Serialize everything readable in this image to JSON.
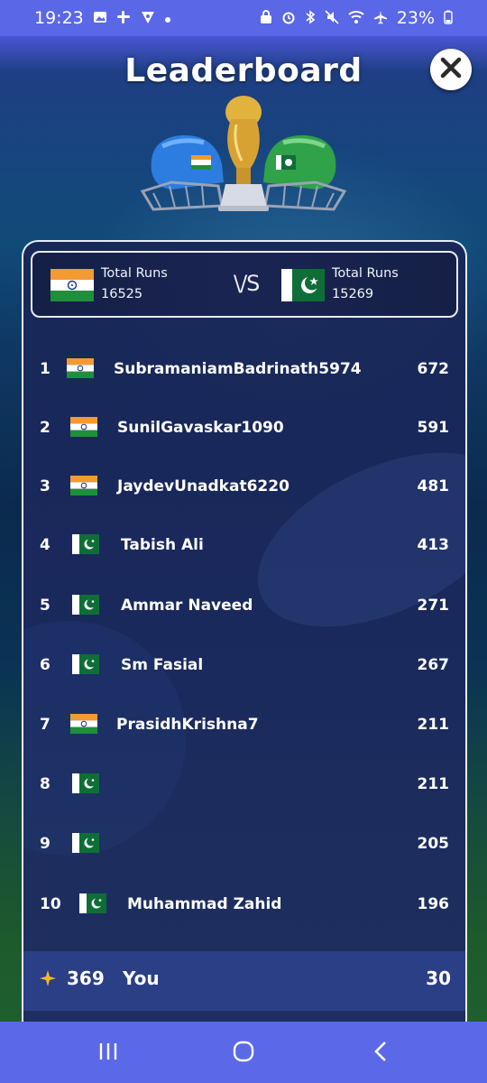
{
  "status_bar": {
    "time": "19:23",
    "battery": "23%"
  },
  "header": {
    "title": "Leaderboard"
  },
  "versus": {
    "left": {
      "label": "Total Runs",
      "value": "16525",
      "flag": "india"
    },
    "vs": "VS",
    "right": {
      "label": "Total Runs",
      "value": "15269",
      "flag": "pakistan"
    }
  },
  "leaderboard": [
    {
      "rank": "1",
      "flag": "india",
      "name": "SubramaniamBadrinath5974",
      "score": "672"
    },
    {
      "rank": "2",
      "flag": "india",
      "name": "SunilGavaskar1090",
      "score": "591"
    },
    {
      "rank": "3",
      "flag": "india",
      "name": "JaydevUnadkat6220",
      "score": "481"
    },
    {
      "rank": "4",
      "flag": "pakistan",
      "name": "Tabish Ali",
      "score": "413"
    },
    {
      "rank": "5",
      "flag": "pakistan",
      "name": "Ammar Naveed",
      "score": "271"
    },
    {
      "rank": "6",
      "flag": "pakistan",
      "name": "Sm Fasial",
      "score": "267"
    },
    {
      "rank": "7",
      "flag": "india",
      "name": "PrasidhKrishna7",
      "score": "211"
    },
    {
      "rank": "8",
      "flag": "pakistan",
      "name": "",
      "score": "211"
    },
    {
      "rank": "9",
      "flag": "pakistan",
      "name": "",
      "score": "205"
    },
    {
      "rank": "10",
      "flag": "pakistan",
      "name": "Muhammad Zahid",
      "score": "196"
    }
  ],
  "you": {
    "rank": "369",
    "name": "You",
    "score": "30"
  },
  "colors": {
    "india_saffron": "#f49a32",
    "india_green": "#1f8f3a",
    "pakistan_green": "#0f6e37",
    "accent_star": "#f4b728",
    "nav_bar": "#5b68e8"
  }
}
